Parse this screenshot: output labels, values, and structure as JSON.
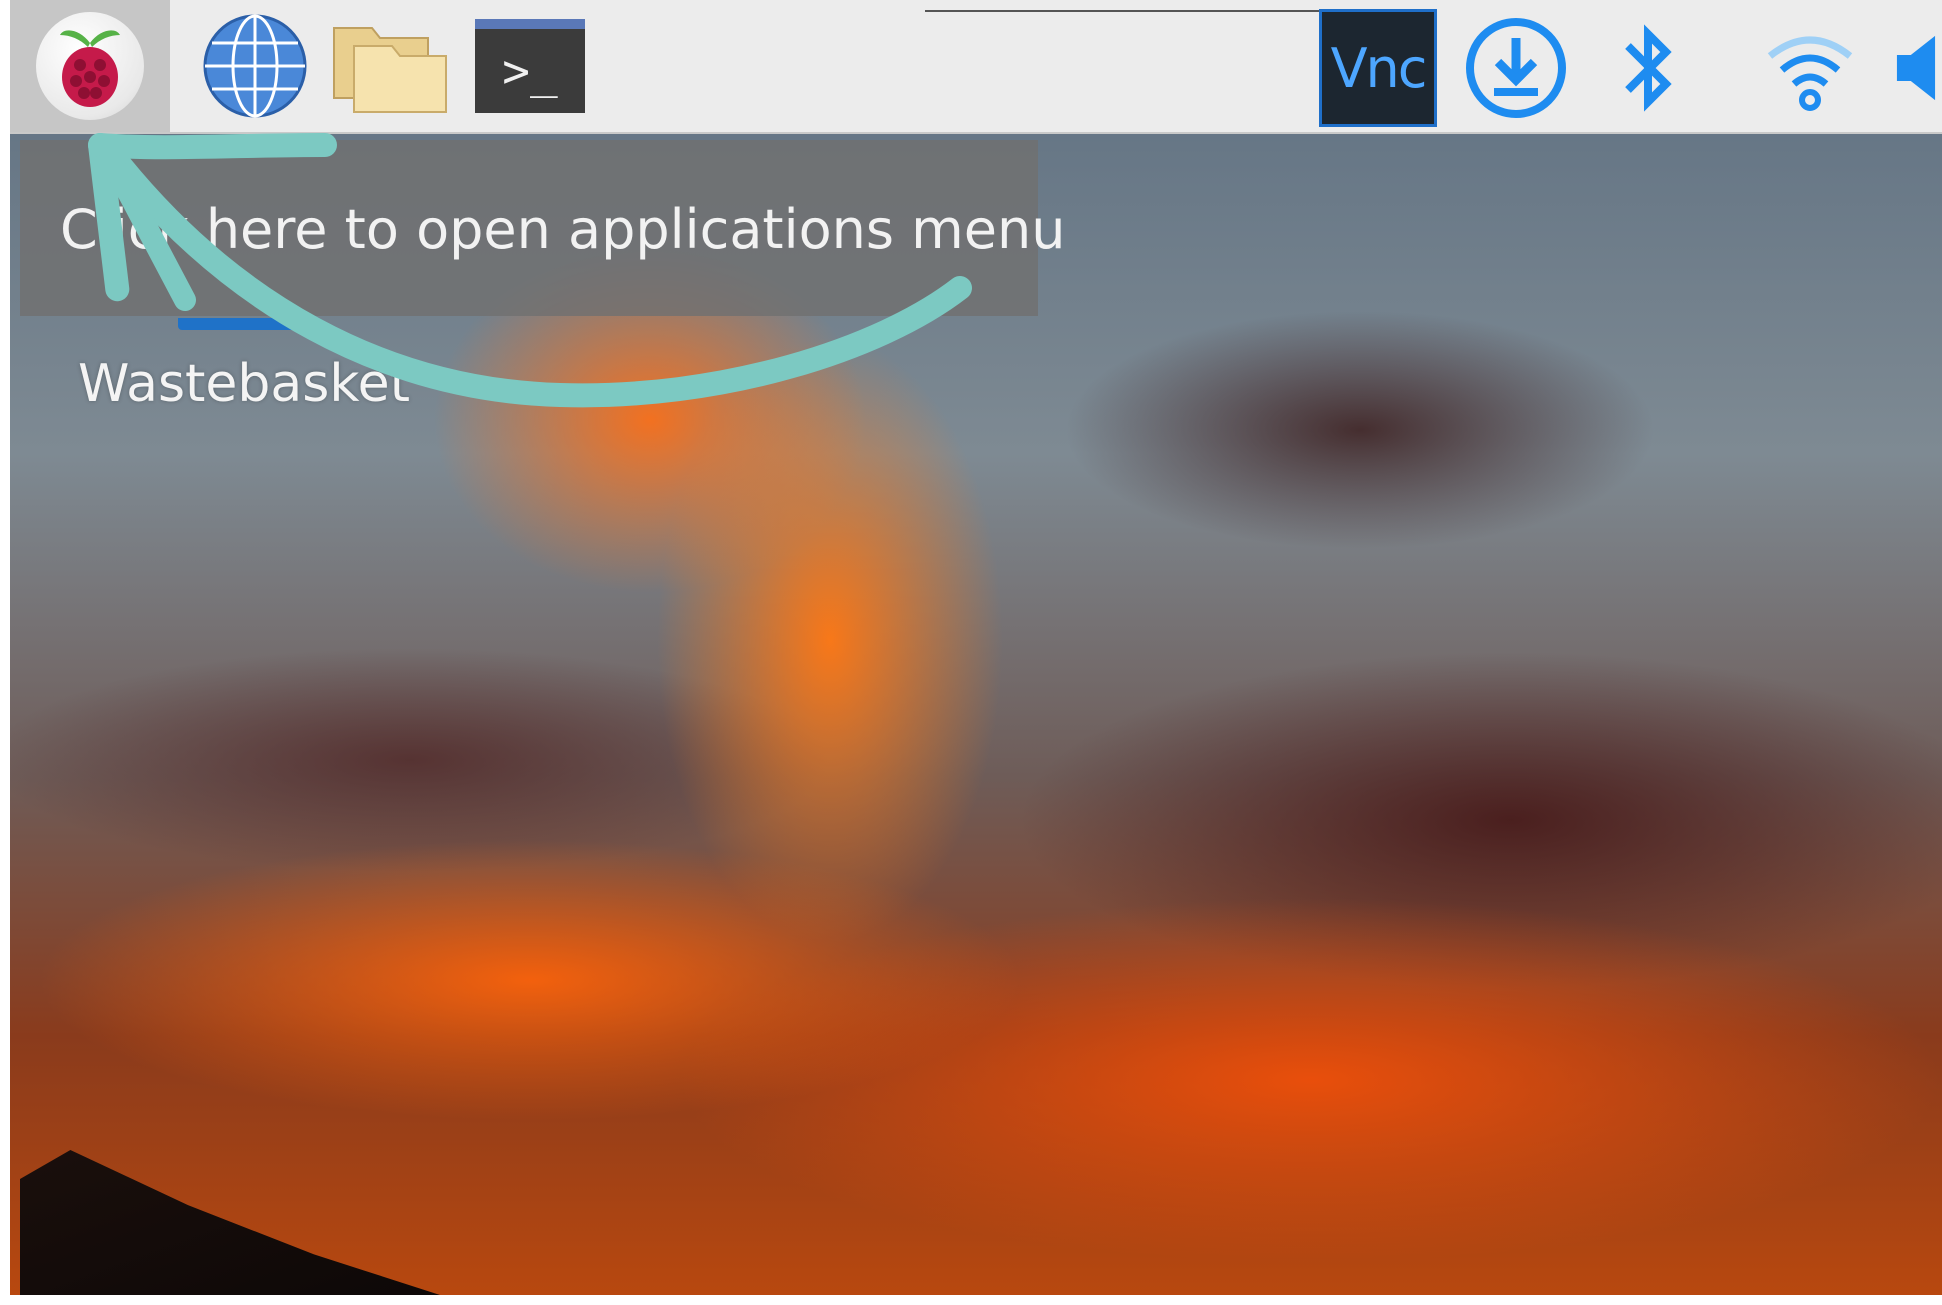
{
  "taskbar": {
    "launchers": [
      {
        "name": "raspberry-menu",
        "icon": "raspberry-pi-icon"
      },
      {
        "name": "web-browser",
        "icon": "globe-icon"
      },
      {
        "name": "file-manager",
        "icon": "folder-icon"
      },
      {
        "name": "terminal",
        "icon": "terminal-icon",
        "text": ">_"
      }
    ],
    "tray": [
      {
        "name": "vnc",
        "icon": "vnc-icon",
        "text": "Vnc"
      },
      {
        "name": "updates",
        "icon": "download-icon"
      },
      {
        "name": "bluetooth",
        "icon": "bluetooth-icon"
      },
      {
        "name": "wifi",
        "icon": "wifi-icon"
      },
      {
        "name": "volume",
        "icon": "speaker-icon"
      }
    ]
  },
  "tooltip": {
    "text": "Click here to open applications menu"
  },
  "desktop": {
    "icons": [
      {
        "label": "Wastebasket",
        "icon": "trash-icon"
      }
    ]
  },
  "annotation": {
    "color": "#7cc9c2",
    "type": "curved-arrow"
  },
  "colors": {
    "tray_blue": "#1e8cf0",
    "panel_bg": "#ececec"
  }
}
